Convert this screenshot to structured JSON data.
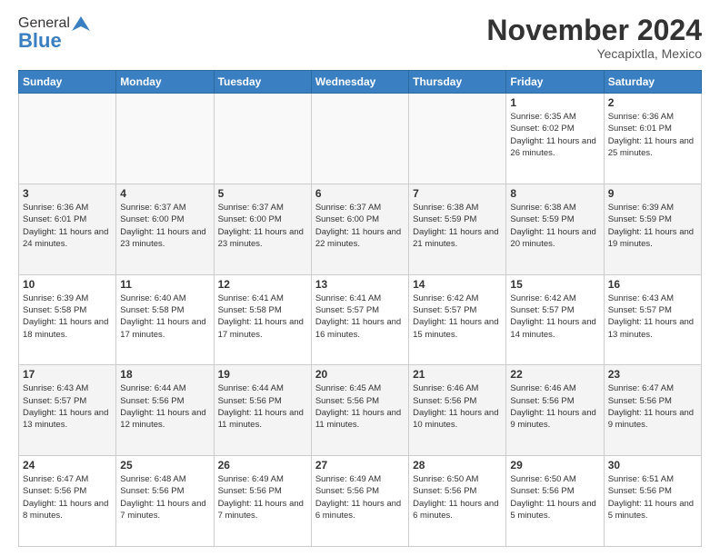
{
  "header": {
    "logo_general": "General",
    "logo_blue": "Blue",
    "month_title": "November 2024",
    "location": "Yecapixtla, Mexico"
  },
  "days_of_week": [
    "Sunday",
    "Monday",
    "Tuesday",
    "Wednesday",
    "Thursday",
    "Friday",
    "Saturday"
  ],
  "weeks": [
    [
      {
        "day": "",
        "info": ""
      },
      {
        "day": "",
        "info": ""
      },
      {
        "day": "",
        "info": ""
      },
      {
        "day": "",
        "info": ""
      },
      {
        "day": "",
        "info": ""
      },
      {
        "day": "1",
        "info": "Sunrise: 6:35 AM\nSunset: 6:02 PM\nDaylight: 11 hours and 26 minutes."
      },
      {
        "day": "2",
        "info": "Sunrise: 6:36 AM\nSunset: 6:01 PM\nDaylight: 11 hours and 25 minutes."
      }
    ],
    [
      {
        "day": "3",
        "info": "Sunrise: 6:36 AM\nSunset: 6:01 PM\nDaylight: 11 hours and 24 minutes."
      },
      {
        "day": "4",
        "info": "Sunrise: 6:37 AM\nSunset: 6:00 PM\nDaylight: 11 hours and 23 minutes."
      },
      {
        "day": "5",
        "info": "Sunrise: 6:37 AM\nSunset: 6:00 PM\nDaylight: 11 hours and 23 minutes."
      },
      {
        "day": "6",
        "info": "Sunrise: 6:37 AM\nSunset: 6:00 PM\nDaylight: 11 hours and 22 minutes."
      },
      {
        "day": "7",
        "info": "Sunrise: 6:38 AM\nSunset: 5:59 PM\nDaylight: 11 hours and 21 minutes."
      },
      {
        "day": "8",
        "info": "Sunrise: 6:38 AM\nSunset: 5:59 PM\nDaylight: 11 hours and 20 minutes."
      },
      {
        "day": "9",
        "info": "Sunrise: 6:39 AM\nSunset: 5:59 PM\nDaylight: 11 hours and 19 minutes."
      }
    ],
    [
      {
        "day": "10",
        "info": "Sunrise: 6:39 AM\nSunset: 5:58 PM\nDaylight: 11 hours and 18 minutes."
      },
      {
        "day": "11",
        "info": "Sunrise: 6:40 AM\nSunset: 5:58 PM\nDaylight: 11 hours and 17 minutes."
      },
      {
        "day": "12",
        "info": "Sunrise: 6:41 AM\nSunset: 5:58 PM\nDaylight: 11 hours and 17 minutes."
      },
      {
        "day": "13",
        "info": "Sunrise: 6:41 AM\nSunset: 5:57 PM\nDaylight: 11 hours and 16 minutes."
      },
      {
        "day": "14",
        "info": "Sunrise: 6:42 AM\nSunset: 5:57 PM\nDaylight: 11 hours and 15 minutes."
      },
      {
        "day": "15",
        "info": "Sunrise: 6:42 AM\nSunset: 5:57 PM\nDaylight: 11 hours and 14 minutes."
      },
      {
        "day": "16",
        "info": "Sunrise: 6:43 AM\nSunset: 5:57 PM\nDaylight: 11 hours and 13 minutes."
      }
    ],
    [
      {
        "day": "17",
        "info": "Sunrise: 6:43 AM\nSunset: 5:57 PM\nDaylight: 11 hours and 13 minutes."
      },
      {
        "day": "18",
        "info": "Sunrise: 6:44 AM\nSunset: 5:56 PM\nDaylight: 11 hours and 12 minutes."
      },
      {
        "day": "19",
        "info": "Sunrise: 6:44 AM\nSunset: 5:56 PM\nDaylight: 11 hours and 11 minutes."
      },
      {
        "day": "20",
        "info": "Sunrise: 6:45 AM\nSunset: 5:56 PM\nDaylight: 11 hours and 11 minutes."
      },
      {
        "day": "21",
        "info": "Sunrise: 6:46 AM\nSunset: 5:56 PM\nDaylight: 11 hours and 10 minutes."
      },
      {
        "day": "22",
        "info": "Sunrise: 6:46 AM\nSunset: 5:56 PM\nDaylight: 11 hours and 9 minutes."
      },
      {
        "day": "23",
        "info": "Sunrise: 6:47 AM\nSunset: 5:56 PM\nDaylight: 11 hours and 9 minutes."
      }
    ],
    [
      {
        "day": "24",
        "info": "Sunrise: 6:47 AM\nSunset: 5:56 PM\nDaylight: 11 hours and 8 minutes."
      },
      {
        "day": "25",
        "info": "Sunrise: 6:48 AM\nSunset: 5:56 PM\nDaylight: 11 hours and 7 minutes."
      },
      {
        "day": "26",
        "info": "Sunrise: 6:49 AM\nSunset: 5:56 PM\nDaylight: 11 hours and 7 minutes."
      },
      {
        "day": "27",
        "info": "Sunrise: 6:49 AM\nSunset: 5:56 PM\nDaylight: 11 hours and 6 minutes."
      },
      {
        "day": "28",
        "info": "Sunrise: 6:50 AM\nSunset: 5:56 PM\nDaylight: 11 hours and 6 minutes."
      },
      {
        "day": "29",
        "info": "Sunrise: 6:50 AM\nSunset: 5:56 PM\nDaylight: 11 hours and 5 minutes."
      },
      {
        "day": "30",
        "info": "Sunrise: 6:51 AM\nSunset: 5:56 PM\nDaylight: 11 hours and 5 minutes."
      }
    ]
  ]
}
